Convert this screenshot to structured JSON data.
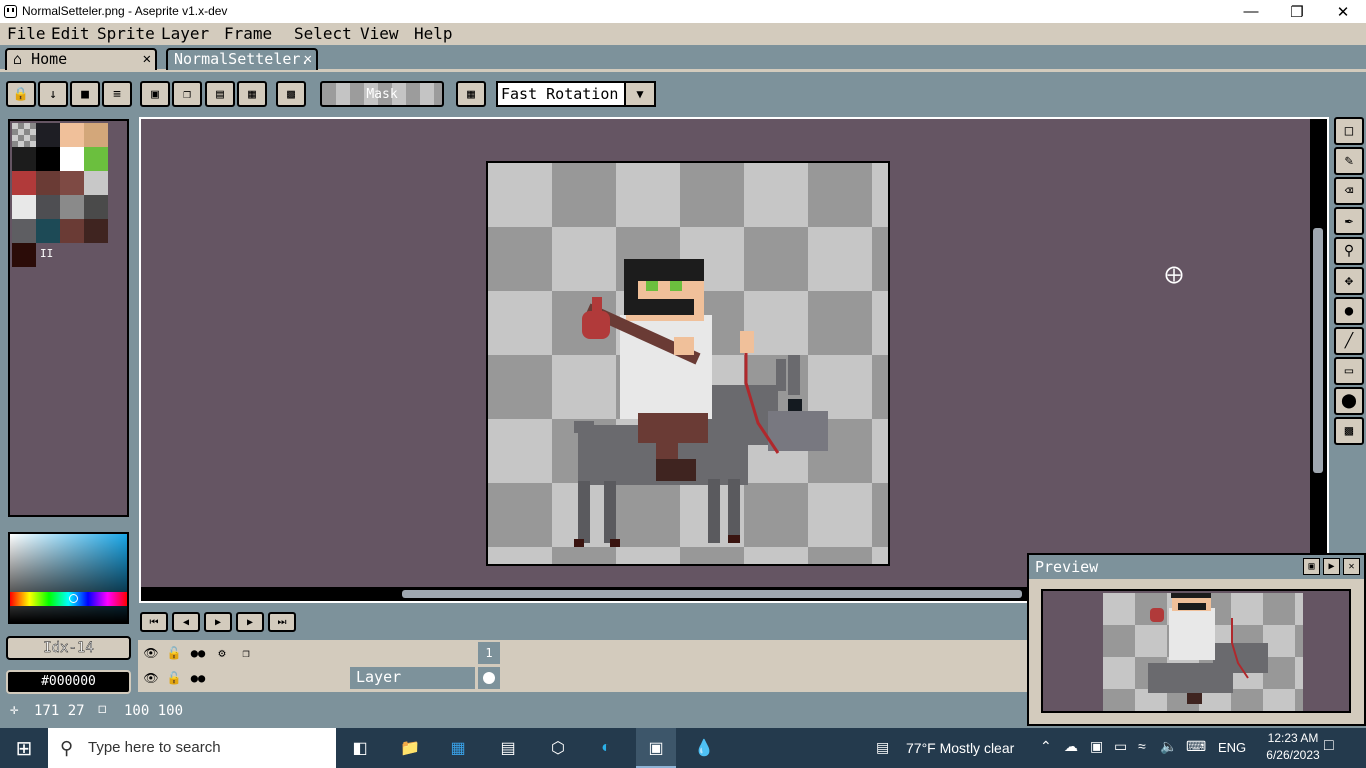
{
  "window": {
    "title": "NormalSetteler.png - Aseprite v1.x-dev"
  },
  "menu": [
    "File",
    "Edit",
    "Sprite",
    "Layer",
    "Frame",
    "Select",
    "View",
    "Help"
  ],
  "tabs": {
    "home": "Home",
    "document": "NormalSetteler."
  },
  "context_bar": {
    "mask_label": "Mask",
    "rotation_algorithm": "Fast Rotation"
  },
  "palette": {
    "colors": [
      "#1e1e24",
      "#f0c09a",
      "#d3a77a",
      "#1c1c1c",
      "#000000",
      "#ffffff",
      "#6bbf3e",
      "#b13a3a",
      "#6a3b35",
      "#7e4a44",
      "#c8c8c8",
      "#e8e8e8",
      "#4e4e52",
      "#8a8a8a",
      "#4a4a4a",
      "#5e5e62",
      "#1d4a56",
      "#6a3b35",
      "#3f2420",
      "#2b0c08"
    ],
    "pause_glyph": "II"
  },
  "color": {
    "index": "Idx-14",
    "hex": "#000000"
  },
  "timeline": {
    "frame_number": "1",
    "layer_name": "Layer"
  },
  "status": {
    "cursor": "171 27",
    "size": "100 100"
  },
  "preview": {
    "title": "Preview"
  },
  "taskbar": {
    "search_placeholder": "Type here to search",
    "weather": "77°F  Mostly clear",
    "language": "ENG",
    "time": "12:23 AM",
    "date": "6/26/2023"
  }
}
